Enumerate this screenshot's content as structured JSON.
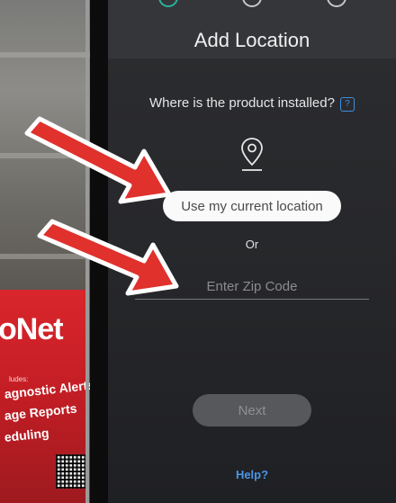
{
  "background_sign": {
    "brand": "oNet",
    "includes": "ludes:",
    "lines": [
      "agnostic Alerts",
      "age Reports",
      "eduling"
    ]
  },
  "header": {
    "title": "Add Location",
    "steps": [
      {
        "state": "active"
      },
      {
        "state": "inactive"
      },
      {
        "state": "inactive"
      }
    ]
  },
  "form": {
    "question": "Where is the product installed?",
    "help_icon": "?",
    "location_icon": "map-pin-icon",
    "use_location_label": "Use my current location",
    "or_label": "Or",
    "zip_value": "",
    "zip_placeholder": "Enter Zip Code",
    "next_label": "Next",
    "help_link": "Help?"
  },
  "colors": {
    "accent_green": "#2bb39c",
    "link_blue": "#4a95e6",
    "screen_bg": "#2c2d30",
    "arrow_red": "#e0312c"
  }
}
